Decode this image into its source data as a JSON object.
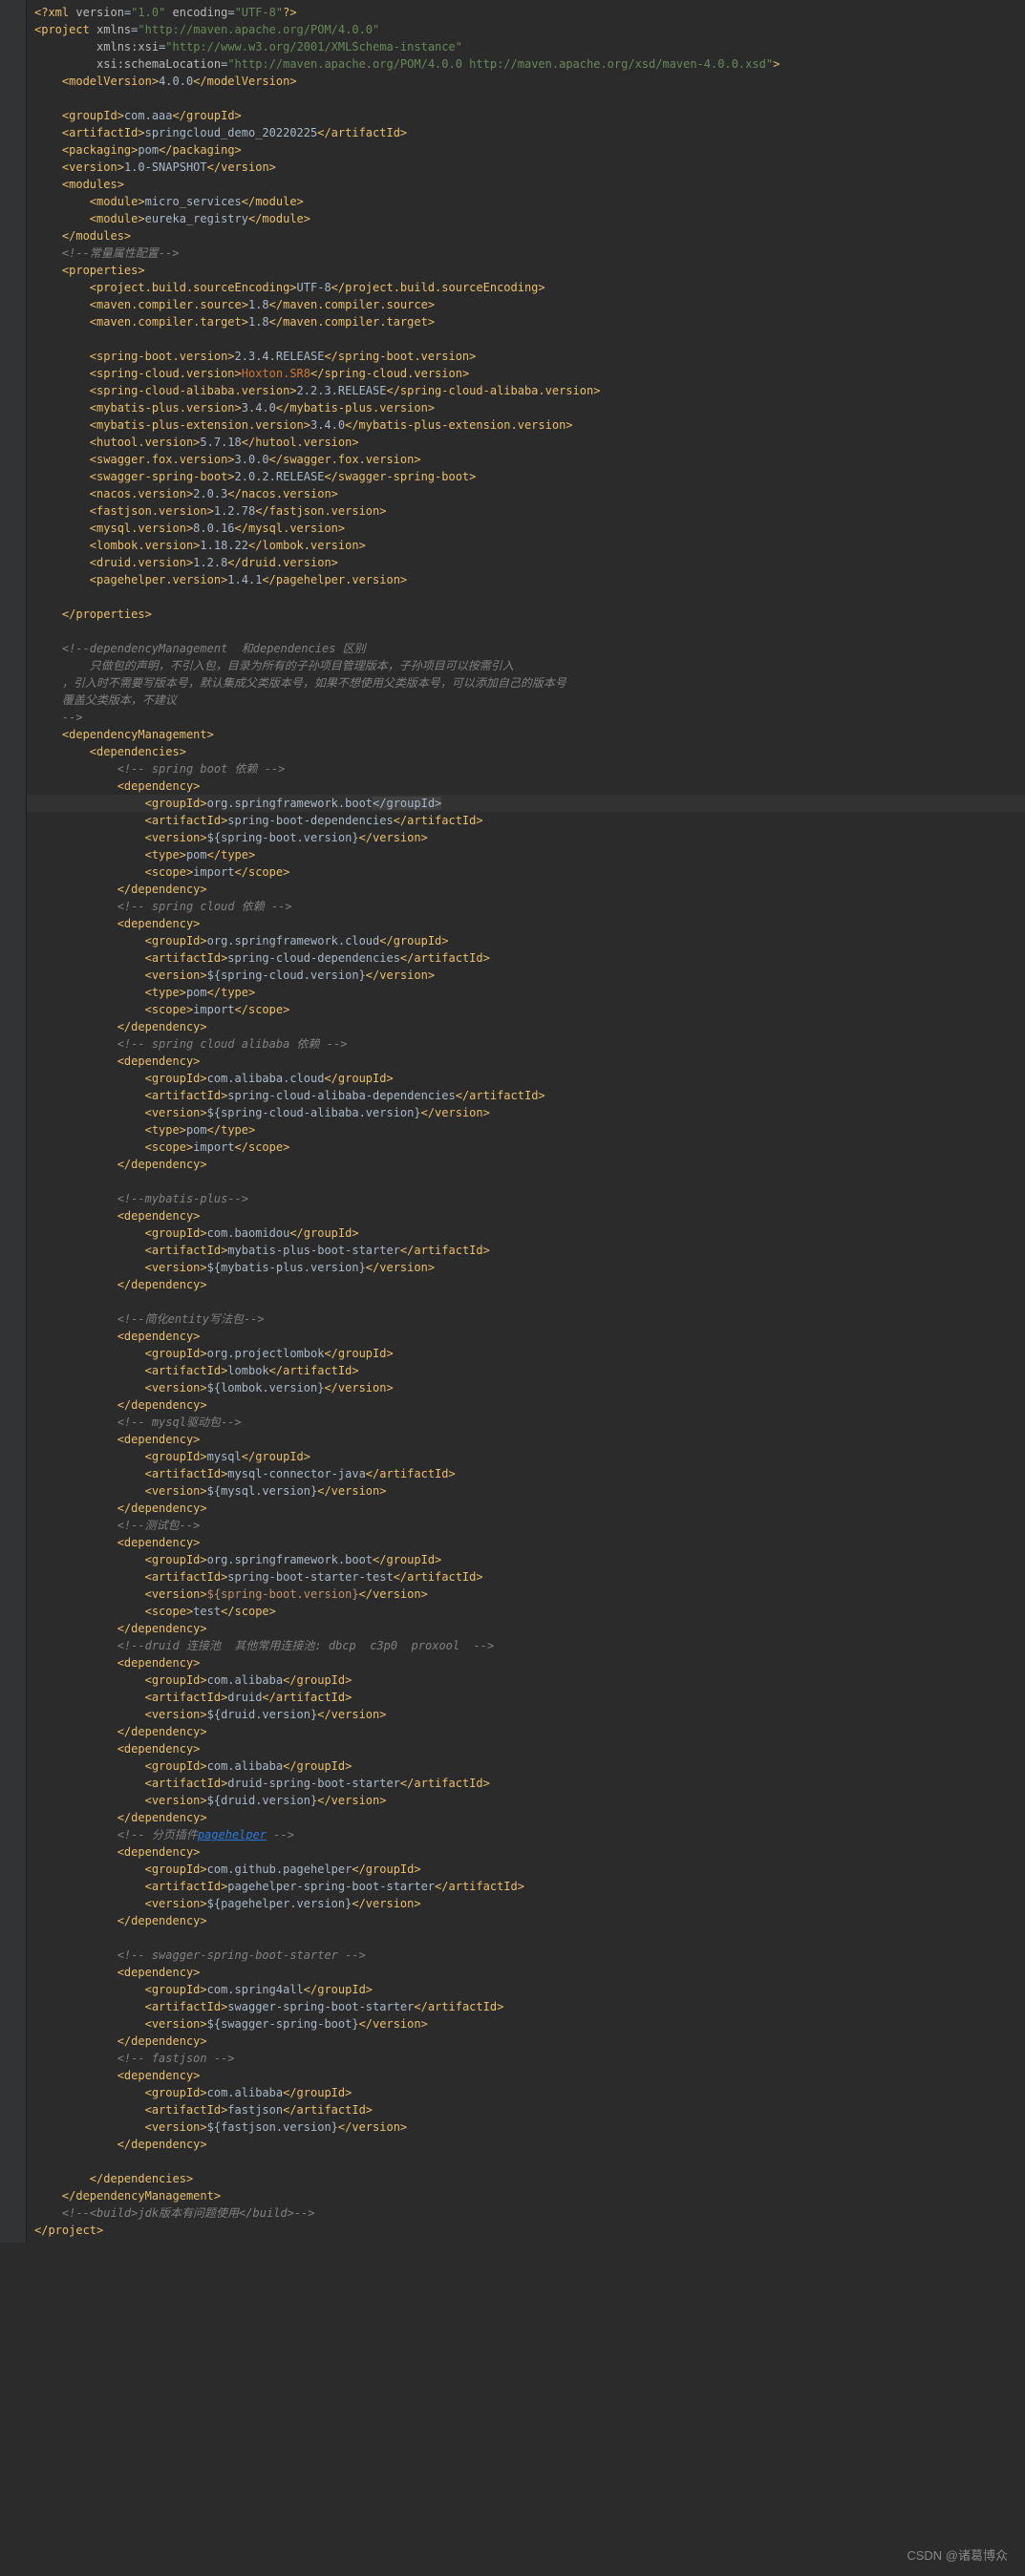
{
  "watermark": "CSDN @诸葛博众",
  "lines": [
    {
      "i": 0,
      "html": "<span class='tag'>&lt;?xml</span> <span class='attr-name'>version</span>=<span class='attr-val'>\"1.0\"</span> <span class='attr-name'>encoding</span>=<span class='attr-val'>\"UTF-8\"</span><span class='tag'>?&gt;</span>"
    },
    {
      "i": 0,
      "html": "<span class='tag'>&lt;project</span> <span class='attr-name'>xmlns</span>=<span class='attr-val'>\"http://maven.apache.org/POM/4.0.0\"</span>"
    },
    {
      "i": 9,
      "html": "<span class='attr-name'>xmlns:xsi</span>=<span class='attr-val'>\"http://www.w3.org/2001/XMLSchema-instance\"</span>"
    },
    {
      "i": 9,
      "html": "<span class='attr-name'>xsi:schemaLocation</span>=<span class='attr-val'>\"http://maven.apache.org/POM/4.0.0 http://maven.apache.org/xsd/maven-4.0.0.xsd\"</span><span class='tag'>&gt;</span>"
    },
    {
      "i": 4,
      "html": "<span class='tag'>&lt;modelVersion&gt;</span>4.0.0<span class='tag'>&lt;/modelVersion&gt;</span>"
    },
    {
      "i": 0,
      "html": ""
    },
    {
      "i": 4,
      "html": "<span class='tag'>&lt;groupId&gt;</span>com.aaa<span class='tag'>&lt;/groupId&gt;</span>"
    },
    {
      "i": 4,
      "html": "<span class='tag'>&lt;artifactId&gt;</span>springcloud_demo_20220225<span class='tag'>&lt;/artifactId&gt;</span>"
    },
    {
      "i": 4,
      "html": "<span class='tag'>&lt;packaging&gt;</span>pom<span class='tag'>&lt;/packaging&gt;</span>"
    },
    {
      "i": 4,
      "html": "<span class='tag'>&lt;version&gt;</span>1.0-SNAPSHOT<span class='tag'>&lt;/version&gt;</span>"
    },
    {
      "i": 4,
      "html": "<span class='tag'>&lt;modules&gt;</span>"
    },
    {
      "i": 8,
      "html": "<span class='tag'>&lt;module&gt;</span>micro_services<span class='tag'>&lt;/module&gt;</span>"
    },
    {
      "i": 8,
      "html": "<span class='tag'>&lt;module&gt;</span>eureka_registry<span class='tag'>&lt;/module&gt;</span>"
    },
    {
      "i": 4,
      "html": "<span class='tag'>&lt;/modules&gt;</span>"
    },
    {
      "i": 4,
      "html": "<span class='comment'>&lt;!--常量属性配置--&gt;</span>"
    },
    {
      "i": 4,
      "html": "<span class='tag'>&lt;properties&gt;</span>"
    },
    {
      "i": 8,
      "html": "<span class='tag'>&lt;project.build.sourceEncoding&gt;</span>UTF-8<span class='tag'>&lt;/project.build.sourceEncoding&gt;</span>"
    },
    {
      "i": 8,
      "html": "<span class='tag'>&lt;maven.compiler.source&gt;</span>1.8<span class='tag'>&lt;/maven.compiler.source&gt;</span>"
    },
    {
      "i": 8,
      "html": "<span class='tag'>&lt;maven.compiler.target&gt;</span>1.8<span class='tag'>&lt;/maven.compiler.target&gt;</span>"
    },
    {
      "i": 0,
      "html": ""
    },
    {
      "i": 8,
      "html": "<span class='tag'>&lt;spring-boot.version&gt;</span>2.3.4.RELEASE<span class='tag'>&lt;/spring-boot.version&gt;</span>"
    },
    {
      "i": 8,
      "html": "<span class='tag'>&lt;spring-cloud.version&gt;</span><span class='keyword'>Hoxton.SR8</span><span class='tag'>&lt;/spring-cloud.version&gt;</span>"
    },
    {
      "i": 8,
      "html": "<span class='tag'>&lt;spring-cloud-alibaba.version&gt;</span>2.2.3.RELEASE<span class='tag'>&lt;/spring-cloud-alibaba.version&gt;</span>"
    },
    {
      "i": 8,
      "html": "<span class='tag'>&lt;mybatis-plus.version&gt;</span>3.4.0<span class='tag'>&lt;/mybatis-plus.version&gt;</span>"
    },
    {
      "i": 8,
      "html": "<span class='tag'>&lt;mybatis-plus-extension.version&gt;</span>3.4.0<span class='tag'>&lt;/mybatis-plus-extension.version&gt;</span>"
    },
    {
      "i": 8,
      "html": "<span class='tag'>&lt;hutool.version&gt;</span>5.7.18<span class='tag'>&lt;/hutool.version&gt;</span>"
    },
    {
      "i": 8,
      "html": "<span class='tag'>&lt;swagger.fox.version&gt;</span>3.0.0<span class='tag'>&lt;/swagger.fox.version&gt;</span>"
    },
    {
      "i": 8,
      "html": "<span class='tag'>&lt;swagger-spring-boot&gt;</span>2.0.2.RELEASE<span class='tag'>&lt;/swagger-spring-boot&gt;</span>"
    },
    {
      "i": 8,
      "html": "<span class='tag'>&lt;nacos.version&gt;</span>2.0.3<span class='tag'>&lt;/nacos.version&gt;</span>"
    },
    {
      "i": 8,
      "html": "<span class='tag'>&lt;fastjson.version&gt;</span>1.2.78<span class='tag'>&lt;/fastjson.version&gt;</span>"
    },
    {
      "i": 8,
      "html": "<span class='tag'>&lt;mysql.version&gt;</span>8.0.16<span class='tag'>&lt;/mysql.version&gt;</span>"
    },
    {
      "i": 8,
      "html": "<span class='tag'>&lt;lombok.version&gt;</span>1.18.22<span class='tag'>&lt;/lombok.version&gt;</span>"
    },
    {
      "i": 8,
      "html": "<span class='tag'>&lt;druid.version&gt;</span>1.2.8<span class='tag'>&lt;/druid.version&gt;</span>"
    },
    {
      "i": 8,
      "html": "<span class='tag'>&lt;pagehelper.version&gt;</span>1.4.1<span class='tag'>&lt;/pagehelper.version&gt;</span>"
    },
    {
      "i": 0,
      "html": ""
    },
    {
      "i": 4,
      "html": "<span class='tag'>&lt;/properties&gt;</span>"
    },
    {
      "i": 0,
      "html": ""
    },
    {
      "i": 4,
      "html": "<span class='comment'>&lt;!--dependencyManagement  和dependencies 区别</span>"
    },
    {
      "i": 8,
      "html": "<span class='comment'>只做包的声明，不引入包，目录为所有的子孙项目管理版本，子孙项目可以按需引入</span>"
    },
    {
      "i": 4,
      "html": "<span class='comment'>，引入时不需要写版本号，默认集成父类版本号，如果不想使用父类版本号，可以添加自己的版本号</span>"
    },
    {
      "i": 4,
      "html": "<span class='comment'>覆盖父类版本，不建议</span>"
    },
    {
      "i": 4,
      "html": "<span class='comment'>--&gt;</span>"
    },
    {
      "i": 4,
      "html": "<span class='tag'>&lt;dependencyManagement&gt;</span>"
    },
    {
      "i": 8,
      "html": "<span class='tag'>&lt;dependencies&gt;</span>"
    },
    {
      "i": 12,
      "html": "<span class='comment'>&lt;!-- spring boot 依赖 --&gt;</span>"
    },
    {
      "i": 12,
      "html": "<span class='tag'>&lt;dependency&gt;</span>"
    },
    {
      "i": 16,
      "html": "<span class='tag'>&lt;groupId&gt;</span>org.springframework.boot<span class='tag highlight-attr'>&lt;/groupId&gt;</span>",
      "hl": true
    },
    {
      "i": 16,
      "html": "<span class='tag'>&lt;artifactId&gt;</span>spring-boot-dependencies<span class='tag'>&lt;/artifactId&gt;</span>"
    },
    {
      "i": 16,
      "html": "<span class='tag'>&lt;version&gt;</span>${spring-boot.version}<span class='tag'>&lt;/version&gt;</span>"
    },
    {
      "i": 16,
      "html": "<span class='tag'>&lt;type&gt;</span>pom<span class='tag'>&lt;/type&gt;</span>"
    },
    {
      "i": 16,
      "html": "<span class='tag'>&lt;scope&gt;</span>import<span class='tag'>&lt;/scope&gt;</span>"
    },
    {
      "i": 12,
      "html": "<span class='tag'>&lt;/dependency&gt;</span>"
    },
    {
      "i": 12,
      "html": "<span class='comment'>&lt;!-- spring cloud 依赖 --&gt;</span>"
    },
    {
      "i": 12,
      "html": "<span class='tag'>&lt;dependency&gt;</span>"
    },
    {
      "i": 16,
      "html": "<span class='tag'>&lt;groupId&gt;</span>org.springframework.cloud<span class='tag'>&lt;/groupId&gt;</span>"
    },
    {
      "i": 16,
      "html": "<span class='tag'>&lt;artifactId&gt;</span>spring-cloud-dependencies<span class='tag'>&lt;/artifactId&gt;</span>"
    },
    {
      "i": 16,
      "html": "<span class='tag'>&lt;version&gt;</span>${spring-cloud.version}<span class='tag'>&lt;/version&gt;</span>"
    },
    {
      "i": 16,
      "html": "<span class='tag'>&lt;type&gt;</span>pom<span class='tag'>&lt;/type&gt;</span>"
    },
    {
      "i": 16,
      "html": "<span class='tag'>&lt;scope&gt;</span>import<span class='tag'>&lt;/scope&gt;</span>"
    },
    {
      "i": 12,
      "html": "<span class='tag'>&lt;/dependency&gt;</span>"
    },
    {
      "i": 12,
      "html": "<span class='comment'>&lt;!-- spring cloud alibaba 依赖 --&gt;</span>"
    },
    {
      "i": 12,
      "html": "<span class='tag'>&lt;dependency&gt;</span>"
    },
    {
      "i": 16,
      "html": "<span class='tag'>&lt;groupId&gt;</span>com.alibaba.cloud<span class='tag'>&lt;/groupId&gt;</span>"
    },
    {
      "i": 16,
      "html": "<span class='tag'>&lt;artifactId&gt;</span>spring-cloud-alibaba-dependencies<span class='tag'>&lt;/artifactId&gt;</span>"
    },
    {
      "i": 16,
      "html": "<span class='tag'>&lt;version&gt;</span>${spring-cloud-alibaba.version}<span class='tag'>&lt;/version&gt;</span>"
    },
    {
      "i": 16,
      "html": "<span class='tag'>&lt;type&gt;</span>pom<span class='tag'>&lt;/type&gt;</span>"
    },
    {
      "i": 16,
      "html": "<span class='tag'>&lt;scope&gt;</span>import<span class='tag'>&lt;/scope&gt;</span>"
    },
    {
      "i": 12,
      "html": "<span class='tag'>&lt;/dependency&gt;</span>"
    },
    {
      "i": 0,
      "html": ""
    },
    {
      "i": 12,
      "html": "<span class='comment'>&lt;!--mybatis-plus--&gt;</span>"
    },
    {
      "i": 12,
      "html": "<span class='tag'>&lt;dependency&gt;</span>"
    },
    {
      "i": 16,
      "html": "<span class='tag'>&lt;groupId&gt;</span>com.baomidou<span class='tag'>&lt;/groupId&gt;</span>"
    },
    {
      "i": 16,
      "html": "<span class='tag'>&lt;artifactId&gt;</span>mybatis-plus-boot-starter<span class='tag'>&lt;/artifactId&gt;</span>"
    },
    {
      "i": 16,
      "html": "<span class='tag'>&lt;version&gt;</span>${mybatis-plus.version}<span class='tag'>&lt;/version&gt;</span>"
    },
    {
      "i": 12,
      "html": "<span class='tag'>&lt;/dependency&gt;</span>"
    },
    {
      "i": 0,
      "html": ""
    },
    {
      "i": 12,
      "html": "<span class='comment'>&lt;!--简化entity写法包--&gt;</span>"
    },
    {
      "i": 12,
      "html": "<span class='tag'>&lt;dependency&gt;</span>"
    },
    {
      "i": 16,
      "html": "<span class='tag'>&lt;groupId&gt;</span>org.projectlombok<span class='tag'>&lt;/groupId&gt;</span>"
    },
    {
      "i": 16,
      "html": "<span class='tag'>&lt;artifactId&gt;</span>lombok<span class='tag'>&lt;/artifactId&gt;</span>"
    },
    {
      "i": 16,
      "html": "<span class='tag'>&lt;version&gt;</span>${lombok.version}<span class='tag'>&lt;/version&gt;</span>"
    },
    {
      "i": 12,
      "html": "<span class='tag'>&lt;/dependency&gt;</span>"
    },
    {
      "i": 12,
      "html": "<span class='comment'>&lt;!-- mysql驱动包--&gt;</span>"
    },
    {
      "i": 12,
      "html": "<span class='tag'>&lt;dependency&gt;</span>"
    },
    {
      "i": 16,
      "html": "<span class='tag'>&lt;groupId&gt;</span>mysql<span class='tag'>&lt;/groupId&gt;</span>"
    },
    {
      "i": 16,
      "html": "<span class='tag'>&lt;artifactId&gt;</span>mysql-connector-java<span class='tag'>&lt;/artifactId&gt;</span>"
    },
    {
      "i": 16,
      "html": "<span class='tag'>&lt;version&gt;</span>${mysql.version}<span class='tag'>&lt;/version&gt;</span>"
    },
    {
      "i": 12,
      "html": "<span class='tag'>&lt;/dependency&gt;</span>"
    },
    {
      "i": 12,
      "html": "<span class='comment'>&lt;!--测试包--&gt;</span>"
    },
    {
      "i": 12,
      "html": "<span class='tag'>&lt;dependency&gt;</span>"
    },
    {
      "i": 16,
      "html": "<span class='tag'>&lt;groupId&gt;</span>org.springframework.boot<span class='tag'>&lt;/groupId&gt;</span>"
    },
    {
      "i": 16,
      "html": "<span class='tag'>&lt;artifactId&gt;</span>spring-boot-starter-test<span class='tag'>&lt;/artifactId&gt;</span>"
    },
    {
      "i": 16,
      "html": "<span class='tag'>&lt;version&gt;</span><span class='warn'>${spring-boot.version}</span><span class='tag'>&lt;/version&gt;</span>"
    },
    {
      "i": 16,
      "html": "<span class='tag'>&lt;scope&gt;</span>test<span class='tag'>&lt;/scope&gt;</span>"
    },
    {
      "i": 12,
      "html": "<span class='tag'>&lt;/dependency&gt;</span>"
    },
    {
      "i": 12,
      "html": "<span class='comment'>&lt;!--druid 连接池  其他常用连接池: dbcp  c3p0  proxool  --&gt;</span>"
    },
    {
      "i": 12,
      "html": "<span class='tag'>&lt;dependency&gt;</span>"
    },
    {
      "i": 16,
      "html": "<span class='tag'>&lt;groupId&gt;</span>com.alibaba<span class='tag'>&lt;/groupId&gt;</span>"
    },
    {
      "i": 16,
      "html": "<span class='tag'>&lt;artifactId&gt;</span>druid<span class='tag'>&lt;/artifactId&gt;</span>"
    },
    {
      "i": 16,
      "html": "<span class='tag'>&lt;version&gt;</span>${druid.version}<span class='tag'>&lt;/version&gt;</span>"
    },
    {
      "i": 12,
      "html": "<span class='tag'>&lt;/dependency&gt;</span>"
    },
    {
      "i": 12,
      "html": "<span class='tag'>&lt;dependency&gt;</span>"
    },
    {
      "i": 16,
      "html": "<span class='tag'>&lt;groupId&gt;</span>com.alibaba<span class='tag'>&lt;/groupId&gt;</span>"
    },
    {
      "i": 16,
      "html": "<span class='tag'>&lt;artifactId&gt;</span>druid-spring-boot-starter<span class='tag'>&lt;/artifactId&gt;</span>"
    },
    {
      "i": 16,
      "html": "<span class='tag'>&lt;version&gt;</span>${druid.version}<span class='tag'>&lt;/version&gt;</span>"
    },
    {
      "i": 12,
      "html": "<span class='tag'>&lt;/dependency&gt;</span>"
    },
    {
      "i": 12,
      "html": "<span class='comment'>&lt;!-- 分页插件<span class='link'>pagehelper</span> --&gt;</span>"
    },
    {
      "i": 12,
      "html": "<span class='tag'>&lt;dependency&gt;</span>"
    },
    {
      "i": 16,
      "html": "<span class='tag'>&lt;groupId&gt;</span>com.github.pagehelper<span class='tag'>&lt;/groupId&gt;</span>"
    },
    {
      "i": 16,
      "html": "<span class='tag'>&lt;artifactId&gt;</span>pagehelper-spring-boot-starter<span class='tag'>&lt;/artifactId&gt;</span>"
    },
    {
      "i": 16,
      "html": "<span class='tag'>&lt;version&gt;</span>${pagehelper.version}<span class='tag'>&lt;/version&gt;</span>"
    },
    {
      "i": 12,
      "html": "<span class='tag'>&lt;/dependency&gt;</span>"
    },
    {
      "i": 0,
      "html": ""
    },
    {
      "i": 12,
      "html": "<span class='comment'>&lt;!-- swagger-spring-boot-starter --&gt;</span>"
    },
    {
      "i": 12,
      "html": "<span class='tag'>&lt;dependency&gt;</span>"
    },
    {
      "i": 16,
      "html": "<span class='tag'>&lt;groupId&gt;</span>com.spring4all<span class='tag'>&lt;/groupId&gt;</span>"
    },
    {
      "i": 16,
      "html": "<span class='tag'>&lt;artifactId&gt;</span>swagger-spring-boot-starter<span class='tag'>&lt;/artifactId&gt;</span>"
    },
    {
      "i": 16,
      "html": "<span class='tag'>&lt;version&gt;</span>${swagger-spring-boot}<span class='tag'>&lt;/version&gt;</span>"
    },
    {
      "i": 12,
      "html": "<span class='tag'>&lt;/dependency&gt;</span>"
    },
    {
      "i": 12,
      "html": "<span class='comment'>&lt;!-- fastjson --&gt;</span>"
    },
    {
      "i": 12,
      "html": "<span class='tag'>&lt;dependency&gt;</span>"
    },
    {
      "i": 16,
      "html": "<span class='tag'>&lt;groupId&gt;</span>com.alibaba<span class='tag'>&lt;/groupId&gt;</span>"
    },
    {
      "i": 16,
      "html": "<span class='tag'>&lt;artifactId&gt;</span>fastjson<span class='tag'>&lt;/artifactId&gt;</span>"
    },
    {
      "i": 16,
      "html": "<span class='tag'>&lt;version&gt;</span>${fastjson.version}<span class='tag'>&lt;/version&gt;</span>"
    },
    {
      "i": 12,
      "html": "<span class='tag'>&lt;/dependency&gt;</span>"
    },
    {
      "i": 0,
      "html": ""
    },
    {
      "i": 8,
      "html": "<span class='tag'>&lt;/dependencies&gt;</span>"
    },
    {
      "i": 4,
      "html": "<span class='tag'>&lt;/dependencyManagement&gt;</span>"
    },
    {
      "i": 4,
      "html": "<span class='comment'>&lt;!--&lt;build&gt;jdk版本有问题使用&lt;/build&gt;--&gt;</span>"
    },
    {
      "i": 0,
      "html": "<span class='tag'>&lt;/project&gt;</span>"
    }
  ]
}
